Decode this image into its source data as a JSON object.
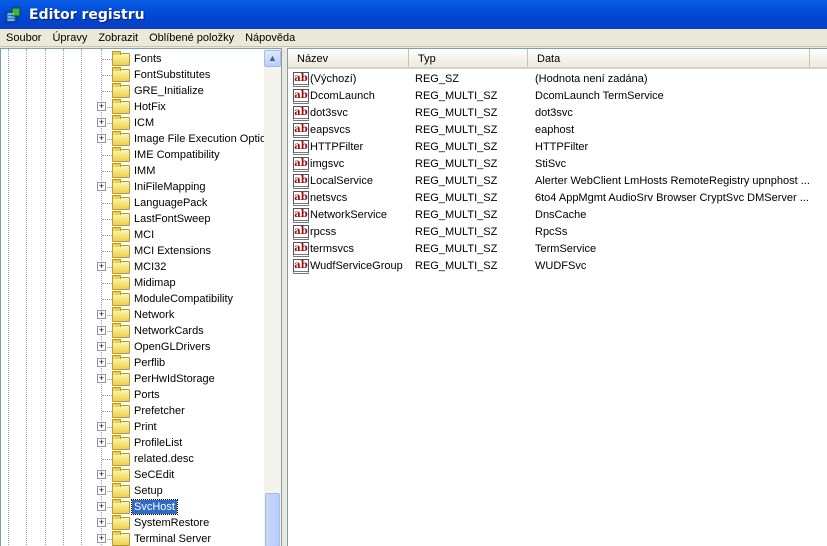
{
  "window": {
    "title": "Editor registru"
  },
  "menu": [
    "Soubor",
    "Úpravy",
    "Zobrazit",
    "Oblíbené položky",
    "Nápověda"
  ],
  "tree": [
    {
      "label": "Fonts",
      "expandable": false
    },
    {
      "label": "FontSubstitutes",
      "expandable": false
    },
    {
      "label": "GRE_Initialize",
      "expandable": false
    },
    {
      "label": "HotFix",
      "expandable": true
    },
    {
      "label": "ICM",
      "expandable": true
    },
    {
      "label": "Image File Execution Options",
      "expandable": true
    },
    {
      "label": "IME Compatibility",
      "expandable": false
    },
    {
      "label": "IMM",
      "expandable": false
    },
    {
      "label": "IniFileMapping",
      "expandable": true
    },
    {
      "label": "LanguagePack",
      "expandable": false
    },
    {
      "label": "LastFontSweep",
      "expandable": false
    },
    {
      "label": "MCI",
      "expandable": false
    },
    {
      "label": "MCI Extensions",
      "expandable": false
    },
    {
      "label": "MCI32",
      "expandable": true
    },
    {
      "label": "Midimap",
      "expandable": false
    },
    {
      "label": "ModuleCompatibility",
      "expandable": false
    },
    {
      "label": "Network",
      "expandable": true
    },
    {
      "label": "NetworkCards",
      "expandable": true
    },
    {
      "label": "OpenGLDrivers",
      "expandable": true
    },
    {
      "label": "Perflib",
      "expandable": true
    },
    {
      "label": "PerHwIdStorage",
      "expandable": true
    },
    {
      "label": "Ports",
      "expandable": false
    },
    {
      "label": "Prefetcher",
      "expandable": false
    },
    {
      "label": "Print",
      "expandable": true
    },
    {
      "label": "ProfileList",
      "expandable": true
    },
    {
      "label": "related.desc",
      "expandable": false
    },
    {
      "label": "SeCEdit",
      "expandable": true
    },
    {
      "label": "Setup",
      "expandable": true
    },
    {
      "label": "SvcHost",
      "expandable": true,
      "selected": true
    },
    {
      "label": "SystemRestore",
      "expandable": true
    },
    {
      "label": "Terminal Server",
      "expandable": true
    }
  ],
  "list": {
    "columns": [
      "Název",
      "Typ",
      "Data"
    ],
    "rows": [
      [
        "(Výchozí)",
        "REG_SZ",
        "(Hodnota není zadána)"
      ],
      [
        "DcomLaunch",
        "REG_MULTI_SZ",
        "DcomLaunch TermService"
      ],
      [
        "dot3svc",
        "REG_MULTI_SZ",
        "dot3svc"
      ],
      [
        "eapsvcs",
        "REG_MULTI_SZ",
        "eaphost"
      ],
      [
        "HTTPFilter",
        "REG_MULTI_SZ",
        "HTTPFilter"
      ],
      [
        "imgsvc",
        "REG_MULTI_SZ",
        "StiSvc"
      ],
      [
        "LocalService",
        "REG_MULTI_SZ",
        "Alerter WebClient LmHosts RemoteRegistry upnphost ..."
      ],
      [
        "netsvcs",
        "REG_MULTI_SZ",
        "6to4 AppMgmt AudioSrv Browser CryptSvc DMServer ..."
      ],
      [
        "NetworkService",
        "REG_MULTI_SZ",
        "DnsCache"
      ],
      [
        "rpcss",
        "REG_MULTI_SZ",
        "RpcSs"
      ],
      [
        "termsvcs",
        "REG_MULTI_SZ",
        "TermService"
      ],
      [
        "WudfServiceGroup",
        "REG_MULTI_SZ",
        "WUDFSvc"
      ]
    ]
  },
  "icons": {
    "value": "ab",
    "expand": "+"
  }
}
